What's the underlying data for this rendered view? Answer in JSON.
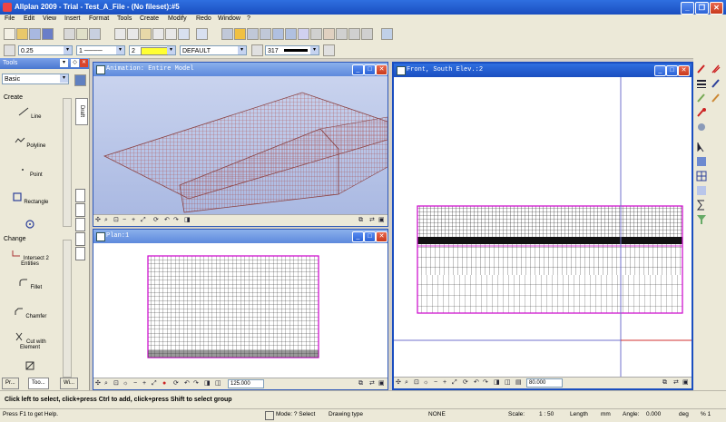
{
  "app": {
    "title": "Allplan 2009 - Trial - Test_A_File - (No fileset):#5",
    "controls": [
      "_",
      "❐",
      "✕"
    ]
  },
  "menu": [
    "File",
    "Edit",
    "View",
    "Insert",
    "Format",
    "Tools",
    "Create",
    "Modify",
    "Redo",
    "Window",
    "?"
  ],
  "format_bar": {
    "pen": "0.25",
    "line": "1",
    "color": "2",
    "layer": "DEFAULT",
    "pattern": "317"
  },
  "palette": {
    "title": "Tools",
    "category": "Basic",
    "tab_label": "Draft",
    "create_header": "Create",
    "create_items": [
      "Line",
      "Polyline",
      "Point",
      "Rectangle"
    ],
    "change_header": "Change",
    "change_items": [
      "Intersect 2 Entities",
      "Fillet",
      "Chamfer",
      "Cut with Element"
    ],
    "bottom_tabs": [
      "Pr...",
      "Too...",
      "Wi..."
    ]
  },
  "windows": {
    "animation": {
      "title": "Animation: Entire Model"
    },
    "plan": {
      "title": "Plan:1",
      "scale_field": "125.000"
    },
    "front": {
      "title": "Front, South Elev.:2",
      "scale_field": "80.000"
    }
  },
  "colors": {
    "titlebar": "#1a4ec0",
    "model_lines": "#b25a5a",
    "plan_border": "#cc00cc",
    "crosshair": "#7070cc"
  },
  "status": {
    "message": "Click left to select, click+press Ctrl to add, click+press Shift to select group"
  },
  "bottom": {
    "help": "Press F1 to get Help.",
    "mode": "Mode: ? Select",
    "drawing_type": "Drawing type",
    "none": "NONE",
    "scale_label": "Scale:",
    "scale_value": "1 : 50",
    "length_label": "Length",
    "length_value": "mm",
    "angle_label": "Angle:",
    "angle_value": "0.000",
    "deg_label": "deg",
    "x_label": "% 1"
  }
}
